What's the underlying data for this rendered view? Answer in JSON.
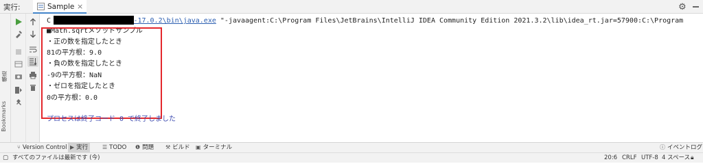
{
  "header": {
    "run_label": "実行:",
    "tab_label": "Sample",
    "tab_close": "×"
  },
  "left_stripe": {
    "structure_label": "構造",
    "bookmarks_label": "Bookmarks"
  },
  "console": {
    "command_prefix": "C",
    "command_link": "openjdk-17.0.2\\bin\\java.exe",
    "command_rest": " \"-javaagent:C:\\Program Files\\JetBrains\\IntelliJ IDEA Community Edition 2021.3.2\\lib\\idea_rt.jar=57900:C:\\Program",
    "lines": [
      "■Math.sqrtメソッドサンプル",
      "・正の数を指定したとき",
      "81の平方根：9.0",
      "・負の数を指定したとき",
      "-9の平方根：NaN",
      "・ゼロを指定したとき",
      "0の平方根：0.0"
    ],
    "exit_message": "プロセスは終了コード 0 で終了しました"
  },
  "bottom_tabs": [
    {
      "label": "Version Control",
      "icon": "branch-icon",
      "active": false
    },
    {
      "label": "実行",
      "icon": "run-icon",
      "active": true
    },
    {
      "label": "TODO",
      "icon": "list-icon",
      "active": false
    },
    {
      "label": "問題",
      "icon": "problems-icon",
      "active": false
    },
    {
      "label": "ビルド",
      "icon": "hammer-icon",
      "active": false
    },
    {
      "label": "ターミナル",
      "icon": "terminal-icon",
      "active": false
    }
  ],
  "event_log": "イベントログ",
  "status": {
    "message": "すべてのファイルは最新です (今)",
    "position": "20:6",
    "line_sep": "CRLF",
    "encoding": "UTF-8",
    "indent": "4 スペース"
  },
  "colors": {
    "link": "#2a5db0",
    "exit_text": "#3d4bb0",
    "highlight_box": "#e3262b",
    "run_green": "#4a9e3f",
    "tab_underline": "#4083c9"
  }
}
